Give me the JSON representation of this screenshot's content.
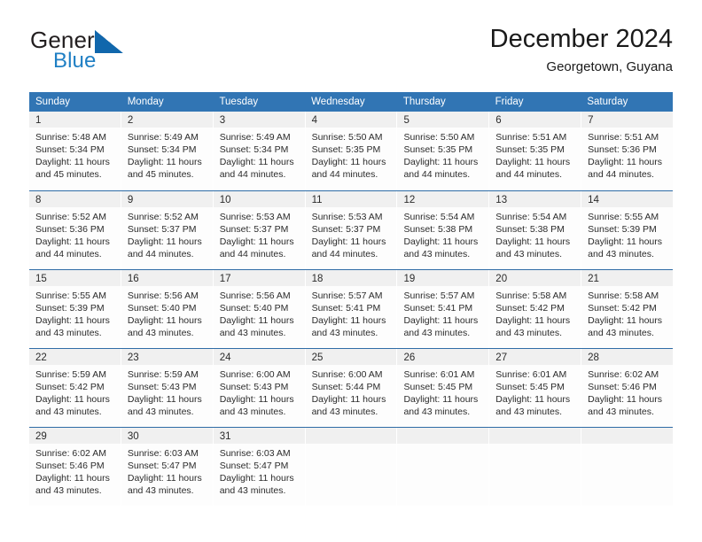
{
  "brand": {
    "name_part1": "General",
    "name_part2": "Blue",
    "mark_color": "#1167ac"
  },
  "header": {
    "title": "December 2024",
    "location": "Georgetown, Guyana"
  },
  "theme": {
    "header_blue": "#3175b4",
    "row_rule_blue": "#2f6ca6",
    "day_band_gray": "#f0f0f0",
    "text_color": "#2b2b2b"
  },
  "weekdays": [
    "Sunday",
    "Monday",
    "Tuesday",
    "Wednesday",
    "Thursday",
    "Friday",
    "Saturday"
  ],
  "weeks": [
    [
      {
        "day": "1",
        "sunrise": "Sunrise: 5:48 AM",
        "sunset": "Sunset: 5:34 PM",
        "daylight": "Daylight: 11 hours and 45 minutes."
      },
      {
        "day": "2",
        "sunrise": "Sunrise: 5:49 AM",
        "sunset": "Sunset: 5:34 PM",
        "daylight": "Daylight: 11 hours and 45 minutes."
      },
      {
        "day": "3",
        "sunrise": "Sunrise: 5:49 AM",
        "sunset": "Sunset: 5:34 PM",
        "daylight": "Daylight: 11 hours and 44 minutes."
      },
      {
        "day": "4",
        "sunrise": "Sunrise: 5:50 AM",
        "sunset": "Sunset: 5:35 PM",
        "daylight": "Daylight: 11 hours and 44 minutes."
      },
      {
        "day": "5",
        "sunrise": "Sunrise: 5:50 AM",
        "sunset": "Sunset: 5:35 PM",
        "daylight": "Daylight: 11 hours and 44 minutes."
      },
      {
        "day": "6",
        "sunrise": "Sunrise: 5:51 AM",
        "sunset": "Sunset: 5:35 PM",
        "daylight": "Daylight: 11 hours and 44 minutes."
      },
      {
        "day": "7",
        "sunrise": "Sunrise: 5:51 AM",
        "sunset": "Sunset: 5:36 PM",
        "daylight": "Daylight: 11 hours and 44 minutes."
      }
    ],
    [
      {
        "day": "8",
        "sunrise": "Sunrise: 5:52 AM",
        "sunset": "Sunset: 5:36 PM",
        "daylight": "Daylight: 11 hours and 44 minutes."
      },
      {
        "day": "9",
        "sunrise": "Sunrise: 5:52 AM",
        "sunset": "Sunset: 5:37 PM",
        "daylight": "Daylight: 11 hours and 44 minutes."
      },
      {
        "day": "10",
        "sunrise": "Sunrise: 5:53 AM",
        "sunset": "Sunset: 5:37 PM",
        "daylight": "Daylight: 11 hours and 44 minutes."
      },
      {
        "day": "11",
        "sunrise": "Sunrise: 5:53 AM",
        "sunset": "Sunset: 5:37 PM",
        "daylight": "Daylight: 11 hours and 44 minutes."
      },
      {
        "day": "12",
        "sunrise": "Sunrise: 5:54 AM",
        "sunset": "Sunset: 5:38 PM",
        "daylight": "Daylight: 11 hours and 43 minutes."
      },
      {
        "day": "13",
        "sunrise": "Sunrise: 5:54 AM",
        "sunset": "Sunset: 5:38 PM",
        "daylight": "Daylight: 11 hours and 43 minutes."
      },
      {
        "day": "14",
        "sunrise": "Sunrise: 5:55 AM",
        "sunset": "Sunset: 5:39 PM",
        "daylight": "Daylight: 11 hours and 43 minutes."
      }
    ],
    [
      {
        "day": "15",
        "sunrise": "Sunrise: 5:55 AM",
        "sunset": "Sunset: 5:39 PM",
        "daylight": "Daylight: 11 hours and 43 minutes."
      },
      {
        "day": "16",
        "sunrise": "Sunrise: 5:56 AM",
        "sunset": "Sunset: 5:40 PM",
        "daylight": "Daylight: 11 hours and 43 minutes."
      },
      {
        "day": "17",
        "sunrise": "Sunrise: 5:56 AM",
        "sunset": "Sunset: 5:40 PM",
        "daylight": "Daylight: 11 hours and 43 minutes."
      },
      {
        "day": "18",
        "sunrise": "Sunrise: 5:57 AM",
        "sunset": "Sunset: 5:41 PM",
        "daylight": "Daylight: 11 hours and 43 minutes."
      },
      {
        "day": "19",
        "sunrise": "Sunrise: 5:57 AM",
        "sunset": "Sunset: 5:41 PM",
        "daylight": "Daylight: 11 hours and 43 minutes."
      },
      {
        "day": "20",
        "sunrise": "Sunrise: 5:58 AM",
        "sunset": "Sunset: 5:42 PM",
        "daylight": "Daylight: 11 hours and 43 minutes."
      },
      {
        "day": "21",
        "sunrise": "Sunrise: 5:58 AM",
        "sunset": "Sunset: 5:42 PM",
        "daylight": "Daylight: 11 hours and 43 minutes."
      }
    ],
    [
      {
        "day": "22",
        "sunrise": "Sunrise: 5:59 AM",
        "sunset": "Sunset: 5:42 PM",
        "daylight": "Daylight: 11 hours and 43 minutes."
      },
      {
        "day": "23",
        "sunrise": "Sunrise: 5:59 AM",
        "sunset": "Sunset: 5:43 PM",
        "daylight": "Daylight: 11 hours and 43 minutes."
      },
      {
        "day": "24",
        "sunrise": "Sunrise: 6:00 AM",
        "sunset": "Sunset: 5:43 PM",
        "daylight": "Daylight: 11 hours and 43 minutes."
      },
      {
        "day": "25",
        "sunrise": "Sunrise: 6:00 AM",
        "sunset": "Sunset: 5:44 PM",
        "daylight": "Daylight: 11 hours and 43 minutes."
      },
      {
        "day": "26",
        "sunrise": "Sunrise: 6:01 AM",
        "sunset": "Sunset: 5:45 PM",
        "daylight": "Daylight: 11 hours and 43 minutes."
      },
      {
        "day": "27",
        "sunrise": "Sunrise: 6:01 AM",
        "sunset": "Sunset: 5:45 PM",
        "daylight": "Daylight: 11 hours and 43 minutes."
      },
      {
        "day": "28",
        "sunrise": "Sunrise: 6:02 AM",
        "sunset": "Sunset: 5:46 PM",
        "daylight": "Daylight: 11 hours and 43 minutes."
      }
    ],
    [
      {
        "day": "29",
        "sunrise": "Sunrise: 6:02 AM",
        "sunset": "Sunset: 5:46 PM",
        "daylight": "Daylight: 11 hours and 43 minutes."
      },
      {
        "day": "30",
        "sunrise": "Sunrise: 6:03 AM",
        "sunset": "Sunset: 5:47 PM",
        "daylight": "Daylight: 11 hours and 43 minutes."
      },
      {
        "day": "31",
        "sunrise": "Sunrise: 6:03 AM",
        "sunset": "Sunset: 5:47 PM",
        "daylight": "Daylight: 11 hours and 43 minutes."
      },
      {
        "day": "",
        "sunrise": "",
        "sunset": "",
        "daylight": ""
      },
      {
        "day": "",
        "sunrise": "",
        "sunset": "",
        "daylight": ""
      },
      {
        "day": "",
        "sunrise": "",
        "sunset": "",
        "daylight": ""
      },
      {
        "day": "",
        "sunrise": "",
        "sunset": "",
        "daylight": ""
      }
    ]
  ]
}
